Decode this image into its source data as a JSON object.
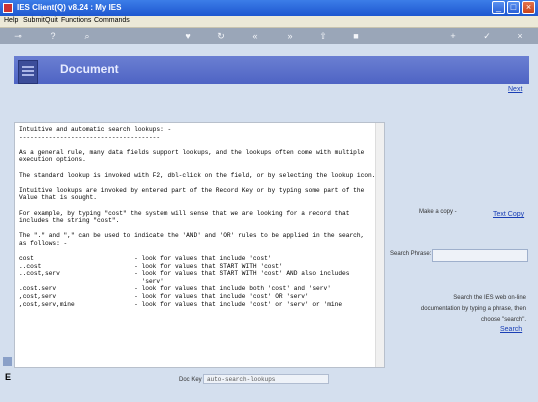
{
  "window": {
    "title": "IES Client(Q) v8.24 : My IES"
  },
  "menu": {
    "items": [
      "Help",
      "Submit",
      "Quit",
      "Functions",
      "Commands"
    ]
  },
  "header": {
    "title": "Document"
  },
  "nav": {
    "next_label": "Next"
  },
  "copy": {
    "label": "Make a copy -",
    "link": "Text Copy"
  },
  "search": {
    "label": "Search Phrase:",
    "value": "",
    "help": "Search the IES web on-line documentation by typing a phrase, then choose \"search\".",
    "button": "Search"
  },
  "doc_key": {
    "label": "Doc Key",
    "value": "auto-search-lookups"
  },
  "document": {
    "text": "Intuitive and automatic search lookups: -\n--------------------------------------\n\nAs a general rule, many data fields support lookups, and the lookups often come with multiple\nexecution options.\n\nThe standard lookup is invoked with F2, dbl-click on the field, or by selecting the lookup icon.\n\nIntuitive lookups are invoked by entered part of the Record Key or by typing some part of the\nValue that is sought.\n\nFor example, by typing \"cost\" the system will sense that we are looking for a record that\nincludes the string \"cost\".\n\nThe \".\" and \",\" can be used to indicate the 'AND' and 'OR' rules to be applied in the search,\nas follows: -\n\ncost                           - look for values that include 'cost'\n..cost                         - look for values that START WITH 'cost'\n..cost,serv                    - look for values that START WITH 'cost' AND also includes\n                                 'serv'\n.cost.serv                     - look for values that include both 'cost' and 'serv'\n,cost,serv                     - look for values that include 'cost' OR 'serv'\n,cost,serv,mine                - look for values that include 'cost' or 'serv' or 'mine"
  },
  "colors": {
    "header": "#5a6fcb",
    "link": "#1a3fb5",
    "titlebar": "#2a63d9"
  }
}
